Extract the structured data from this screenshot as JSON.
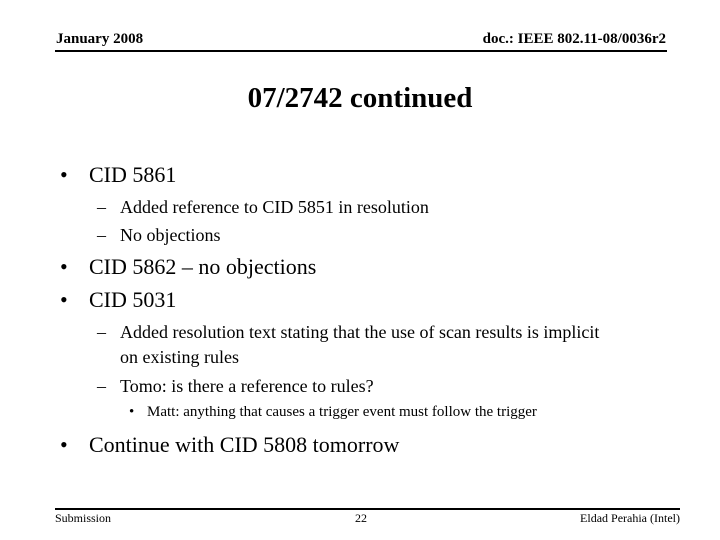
{
  "header": {
    "date": "January 2008",
    "doc_id": "doc.: IEEE 802.11-08/0036r2"
  },
  "title": "07/2742 continued",
  "bullets": [
    {
      "marker": "•",
      "text": "CID 5861",
      "bold": false,
      "children": [
        {
          "marker": "–",
          "text": "Added reference to CID 5851 in resolution"
        },
        {
          "marker": "–",
          "text": "No objections"
        }
      ]
    },
    {
      "marker": "•",
      "text": "CID 5862 – no objections",
      "bold": false
    },
    {
      "marker": "•",
      "text": "CID 5031",
      "bold": false,
      "children": [
        {
          "marker": "–",
          "text_line1": "Added resolution text stating that the use of scan results is implicit",
          "text_line2": "on existing rules"
        },
        {
          "marker": "–",
          "text": "Tomo: is there a reference to rules?",
          "children": [
            {
              "marker": "•",
              "text": "Matt: anything that causes a trigger event must follow the trigger"
            }
          ]
        }
      ]
    },
    {
      "marker": "•",
      "text": "Continue with CID 5808 tomorrow",
      "bold": false
    }
  ],
  "footer": {
    "left": "Submission",
    "page_number": "22",
    "author": "Eldad Perahia (Intel)"
  }
}
